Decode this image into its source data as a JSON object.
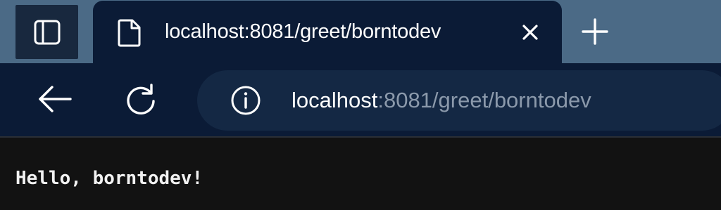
{
  "tab": {
    "title": "localhost:8081/greet/borntodev"
  },
  "address": {
    "host": "localhost",
    "rest": ":8081/greet/borntodev"
  },
  "page": {
    "text": "Hello, borntodev!"
  },
  "icons": {
    "sidebar": "sidebar-panel-icon",
    "page": "document-icon",
    "close": "close-icon",
    "new_tab": "plus-icon",
    "back": "arrow-left-icon",
    "reload": "refresh-icon",
    "info": "info-icon"
  },
  "colors": {
    "tabstrip": "#4b6a86",
    "toolbar": "#0b1b36",
    "addressbar": "#142844",
    "url_muted": "#8b99ab",
    "page_bg": "#121212"
  }
}
